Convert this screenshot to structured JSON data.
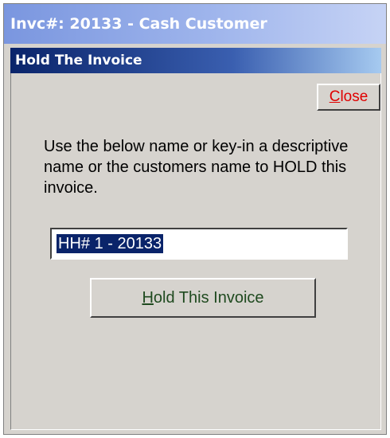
{
  "window": {
    "title": "Invc#: 20133 - Cash Customer"
  },
  "panel": {
    "header": "Hold The Invoice"
  },
  "close_button": {
    "mnemonic": "C",
    "rest": "lose"
  },
  "instructions": {
    "text": "Use the below name or key-in a descriptive name or the customers name to HOLD this invoice."
  },
  "hold_name_input": {
    "value": "HH# 1 - 20133"
  },
  "hold_button": {
    "mnemonic": "H",
    "rest": "old This Invoice"
  },
  "colors": {
    "title_gradient_start": "#7a96df",
    "header_gradient_start": "#0a246a",
    "window_background": "#d6d3ce",
    "close_text": "#e00000",
    "hold_text": "#1f4a1f",
    "selection": "#0a246a"
  }
}
